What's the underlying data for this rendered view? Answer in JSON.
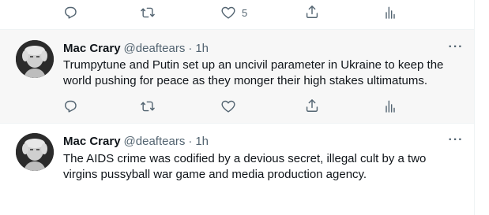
{
  "top_actions": {
    "like_count": "5"
  },
  "tweets": [
    {
      "name": "Mac Crary",
      "handle": "@deaftears",
      "separator": "·",
      "time": "1h",
      "more": "···",
      "text": "Trumpytune and Putin set up an uncivil parameter in Ukraine to keep the world pushing for peace as they monger their high stakes ultimatums."
    },
    {
      "name": "Mac Crary",
      "handle": "@deaftears",
      "separator": "·",
      "time": "1h",
      "more": "···",
      "text": "The AIDS crime was codified by a devious secret, illegal cult by a two virgins pussyball war game and media production agency."
    }
  ],
  "icons": {
    "reply": "reply-icon",
    "retweet": "retweet-icon",
    "like": "heart-icon",
    "share": "share-icon",
    "analytics": "analytics-icon"
  },
  "colors": {
    "text": "#0f1419",
    "secondary": "#536471",
    "divider": "#eff3f4",
    "hover_bg": "#f7f7f7"
  }
}
